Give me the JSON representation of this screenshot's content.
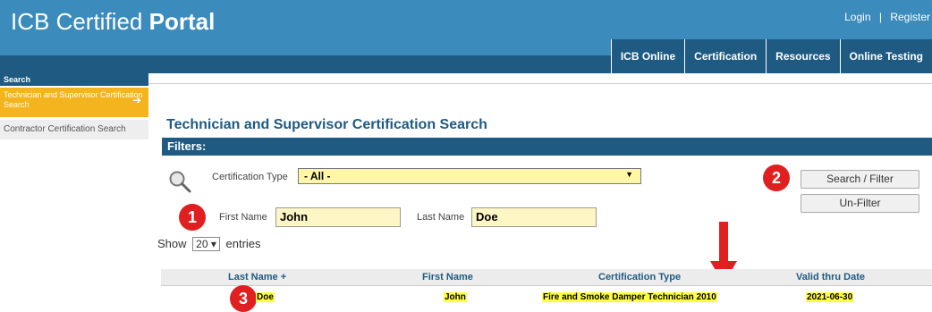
{
  "header": {
    "logo_regular": "ICB Certified ",
    "logo_bold": "Portal",
    "login": "Login",
    "separator": "|",
    "register": "Register",
    "nav": [
      "ICB Online",
      "Certification",
      "Resources",
      "Online Testing"
    ]
  },
  "sidebar": {
    "heading": "Search",
    "items": [
      {
        "label": "Technician and Supervisor Certification Search",
        "active": true
      },
      {
        "label": "Contractor Certification Search",
        "active": false
      }
    ]
  },
  "main": {
    "title": "Technician and Supervisor Certification Search",
    "filters_label": "Filters:",
    "cert_type_label": "Certification Type",
    "cert_type_value": "- All -",
    "first_name_label": "First Name",
    "first_name_value": "John",
    "last_name_label": "Last Name",
    "last_name_value": "Doe",
    "search_button": "Search / Filter",
    "unfilter_button": "Un-Filter",
    "show_label": "Show",
    "show_value": "20",
    "entries_label": "entries"
  },
  "annotations": {
    "badge_1": "1",
    "badge_2": "2",
    "badge_3": "3",
    "badge_color": "#e02020"
  },
  "table": {
    "columns": [
      "Last Name",
      "First Name",
      "Certification Type",
      "Valid thru Date"
    ],
    "sort_indicator": "+",
    "rows": [
      {
        "last_name": "Doe",
        "first_name": "John",
        "certification_type": "Fire and Smoke Damper Technician 2010",
        "valid_thru": "2021-06-30"
      }
    ]
  },
  "colors": {
    "header_blue": "#3b8bbd",
    "nav_dark_blue": "#1e5a82",
    "active_orange": "#f4b41e",
    "highlight_yellow": "#ffff3c"
  }
}
